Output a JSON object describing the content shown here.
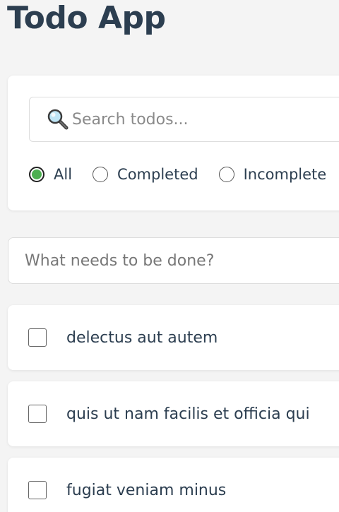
{
  "app": {
    "title": "Todo App"
  },
  "search": {
    "icon": "magnifier-icon",
    "placeholder": "Search todos...",
    "value": ""
  },
  "filters": {
    "options": [
      {
        "label": "All",
        "checked": true
      },
      {
        "label": "Completed",
        "checked": false
      },
      {
        "label": "Incomplete",
        "checked": false
      }
    ],
    "selected": "All",
    "accent_color": "#4caf50"
  },
  "new_todo": {
    "placeholder": "What needs to be done?",
    "value": ""
  },
  "todos": [
    {
      "text": "delectus aut autem",
      "completed": false
    },
    {
      "text": "quis ut nam facilis et officia qui",
      "completed": false
    },
    {
      "text": "fugiat veniam minus",
      "completed": false
    }
  ],
  "colors": {
    "title": "#2c3e50",
    "background": "#f4f4f4",
    "card": "#ffffff"
  }
}
